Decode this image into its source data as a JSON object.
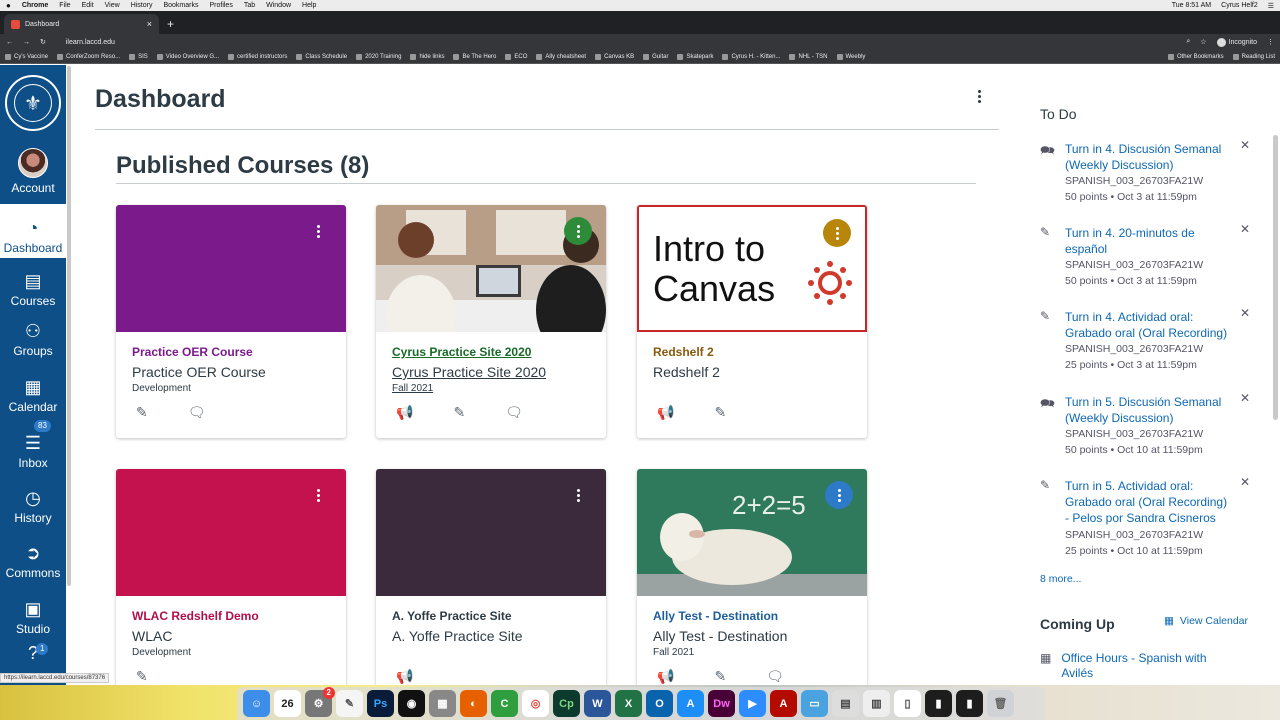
{
  "mac_menubar": {
    "apple": "",
    "app": "Chrome",
    "items": [
      "File",
      "Edit",
      "View",
      "History",
      "Bookmarks",
      "Profiles",
      "Tab",
      "Window",
      "Help"
    ],
    "right_time": "Tue 8:51 AM",
    "right_user": "Cyrus Helf2"
  },
  "browser": {
    "tab_title": "Dashboard",
    "new_tab_symbol": "+",
    "close_tab_symbol": "×",
    "url": "ilearn.laccd.edu",
    "incognito_label": "Incognito",
    "bookmarks": [
      "Cy's Vaccine",
      "ConferZoom Reso...",
      "SIS",
      "Video Overview G...",
      "certified instructors",
      "Class Schedule",
      "2020 Training",
      "hide links",
      "Be The Hero",
      "ECO",
      "Ally cheatsheet",
      "Canvas KB",
      "Guitar",
      "Skatepark",
      "Cyrus H. - Kitten...",
      "NHL - TSN",
      "Weebly"
    ],
    "bookmarks_right": [
      "Other Bookmarks",
      "Reading List"
    ],
    "status_url": "https://ilearn.laccd.edu/courses/87376"
  },
  "global_nav": {
    "items": [
      {
        "label": "Account",
        "icon": "avatar"
      },
      {
        "label": "Dashboard",
        "icon": "dashboard-icon"
      },
      {
        "label": "Courses",
        "icon": "courses-icon"
      },
      {
        "label": "Groups",
        "icon": "groups-icon"
      },
      {
        "label": "Calendar",
        "icon": "calendar-icon"
      },
      {
        "label": "Inbox",
        "icon": "inbox-icon"
      },
      {
        "label": "History",
        "icon": "history-icon"
      },
      {
        "label": "Commons",
        "icon": "commons-icon"
      },
      {
        "label": "Studio",
        "icon": "studio-icon"
      },
      {
        "label": "",
        "icon": "help-icon"
      }
    ],
    "inbox_badge": "83",
    "help_badge": "1"
  },
  "page": {
    "title": "Dashboard",
    "section_title": "Published Courses (8)"
  },
  "cards": [
    {
      "code": "Practice OER Course",
      "name": "Practice OER Course",
      "term": "Development",
      "color": "#7b1a8b",
      "code_color": "#7b1a8b"
    },
    {
      "code": "Cyrus Practice Site 2020",
      "name": "Cyrus Practice Site 2020",
      "term": "Fall 2021",
      "color": "#2e8b3a",
      "code_color": "#1a6a2a"
    },
    {
      "code": "Redshelf 2",
      "name": "Redshelf 2",
      "term": "",
      "color": "#b8860b",
      "code_color": "#8a5a0b"
    },
    {
      "code": "WLAC Redshelf Demo",
      "name": "WLAC",
      "term": "Development",
      "color": "#c4124e",
      "code_color": "#b0104a"
    },
    {
      "code": "A. Yoffe Practice Site",
      "name": "A. Yoffe Practice Site",
      "term": "",
      "color": "#3b2a3b",
      "code_color": "#2d3b45"
    },
    {
      "code": "Ally Test - Destination",
      "name": "Ally Test - Destination",
      "term": "Fall 2021",
      "color": "#2d7bc8",
      "code_color": "#1b5e9e"
    }
  ],
  "intro_card_text": {
    "line1": "Intro to",
    "line2": "Canvas"
  },
  "todo": {
    "title": "To Do",
    "items": [
      {
        "title": "Turn in 4. Discusión Semanal (Weekly Discussion)",
        "course": "SPANISH_003_26703FA21W",
        "meta": "50 points • Oct 3 at 11:59pm",
        "icon": "discussion-icon"
      },
      {
        "title": "Turn in 4. 20-minutos de español",
        "course": "SPANISH_003_26703FA21W",
        "meta": "50 points • Oct 3 at 11:59pm",
        "icon": "assignment-icon"
      },
      {
        "title": "Turn in 4. Actividad oral: Grabado oral (Oral Recording)",
        "course": "SPANISH_003_26703FA21W",
        "meta": "25 points • Oct 3 at 11:59pm",
        "icon": "assignment-icon"
      },
      {
        "title": "Turn in 5. Discusión Semanal (Weekly Discussion)",
        "course": "SPANISH_003_26703FA21W",
        "meta": "50 points • Oct 10 at 11:59pm",
        "icon": "discussion-icon"
      },
      {
        "title": "Turn in 5. Actividad oral: Grabado oral (Oral Recording) - Pelos por Sandra Cisneros",
        "course": "SPANISH_003_26703FA21W",
        "meta": "25 points • Oct 10 at 11:59pm",
        "icon": "assignment-icon"
      }
    ],
    "more": "8 more...",
    "coming_up": "Coming Up",
    "view_calendar": "View Calendar",
    "office_hours": "Office Hours - Spanish with Avilés"
  },
  "dock": {
    "apps": [
      "Finder",
      "Calendar",
      "System Preferences",
      "TextEdit",
      "Photoshop",
      "Camera",
      "Calculator",
      "Firefox",
      "Camtasia",
      "Chrome",
      "Captivate",
      "Word",
      "Excel",
      "Outlook",
      "App Store",
      "Dreamweaver",
      "Zoom",
      "Acrobat",
      "Folder",
      "Preview",
      "Notes",
      "Document",
      "Terminal",
      "Terminal",
      "Trash"
    ],
    "calendar_day": "26",
    "sysprefs_badge": "2",
    "ps_label": "Ps",
    "cp_label": "Cp",
    "dw_label": "Dw"
  }
}
